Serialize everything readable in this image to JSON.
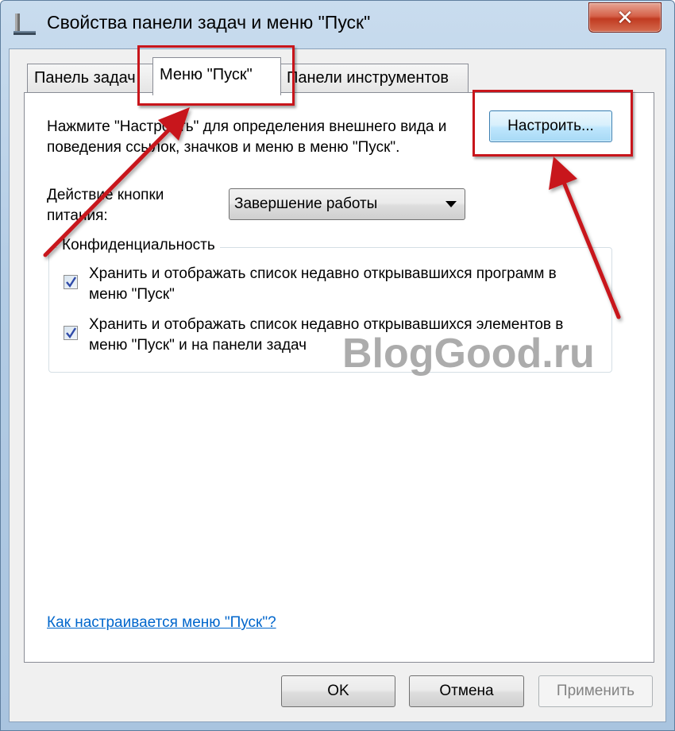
{
  "window": {
    "title": "Свойства панели задач и меню \"Пуск\"",
    "close_label": "✕"
  },
  "tabs": [
    {
      "label": "Панель задач",
      "active": false
    },
    {
      "label": "Меню \"Пуск\"",
      "active": true
    },
    {
      "label": "Панели инструментов",
      "active": false
    }
  ],
  "start_menu": {
    "description": "Нажмите \"Настроить\" для определения внешнего вида и поведения ссылок, значков и меню в меню \"Пуск\".",
    "customize_button": "Настроить...",
    "power_label": "Действие кнопки питания:",
    "power_value": "Завершение работы",
    "privacy": {
      "legend": "Конфиденциальность",
      "items": [
        {
          "label": "Хранить и отображать список недавно открывавшихся программ в меню \"Пуск\"",
          "checked": true
        },
        {
          "label": "Хранить и отображать список недавно открывавшихся элементов в меню \"Пуск\" и на панели задач",
          "checked": true
        }
      ]
    },
    "help_link": "Как настраивается меню \"Пуск\"?"
  },
  "footer": {
    "ok": "OK",
    "cancel": "Отмена",
    "apply": "Применить"
  },
  "watermark": "BlogGood.ru",
  "colors": {
    "annotation_red": "#c8151b",
    "link": "#0066cc",
    "frame": "#b3cce5"
  }
}
